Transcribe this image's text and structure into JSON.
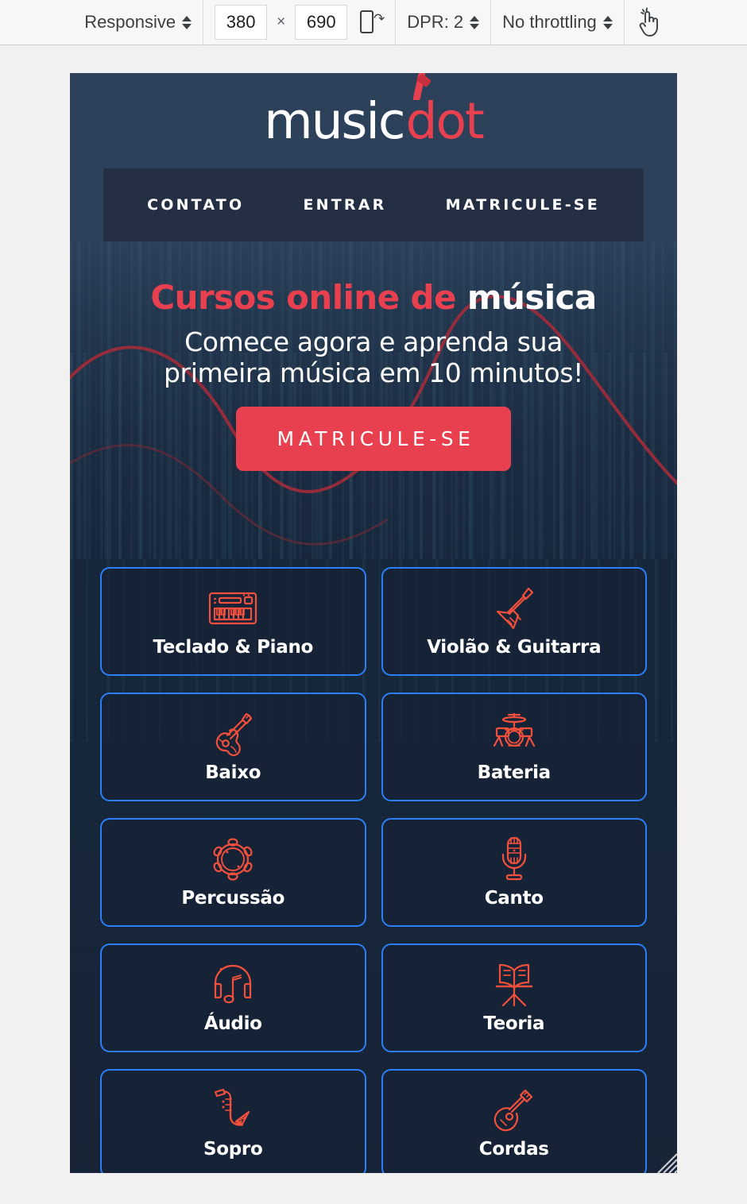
{
  "devtools": {
    "device_preset": "Responsive",
    "width": "380",
    "separator": "×",
    "height": "690",
    "dpr": "DPR: 2",
    "throttling": "No throttling",
    "rotate_icon": "rotate-device-icon",
    "touch_icon": "touch-cursor-icon"
  },
  "page": {
    "logo": {
      "part_white": "music",
      "part_red": "dot"
    },
    "nav": [
      {
        "label": "CONTATO",
        "name": "nav-item-contato"
      },
      {
        "label": "ENTRAR",
        "name": "nav-item-entrar"
      },
      {
        "label": "MATRICULE-SE",
        "name": "nav-item-matricule-se"
      }
    ],
    "hero": {
      "title_red": "Cursos online de",
      "title_white": "música",
      "subtitle_line1": "Comece agora e aprenda sua",
      "subtitle_line2": "primeira música em 10 minutos!",
      "cta_label": "MATRICULE-SE"
    },
    "courses": [
      {
        "label": "Teclado & Piano",
        "icon": "keyboard-piano-icon"
      },
      {
        "label": "Violão & Guitarra",
        "icon": "electric-guitar-icon"
      },
      {
        "label": "Baixo",
        "icon": "bass-guitar-icon"
      },
      {
        "label": "Bateria",
        "icon": "drum-kit-icon"
      },
      {
        "label": "Percussão",
        "icon": "tambourine-icon"
      },
      {
        "label": "Canto",
        "icon": "microphone-icon"
      },
      {
        "label": "Áudio",
        "icon": "headphones-note-icon"
      },
      {
        "label": "Teoria",
        "icon": "music-stand-icon"
      },
      {
        "label": "Sopro",
        "icon": "saxophone-icon"
      },
      {
        "label": "Cordas",
        "icon": "mandolin-icon"
      }
    ]
  },
  "colors": {
    "brand_red": "#e8404f",
    "icon_red": "#f2503c",
    "card_border_blue": "#2d7ff9",
    "header_navy": "#2c4059",
    "nav_navy": "#232e42",
    "deep_navy": "#16273c"
  }
}
